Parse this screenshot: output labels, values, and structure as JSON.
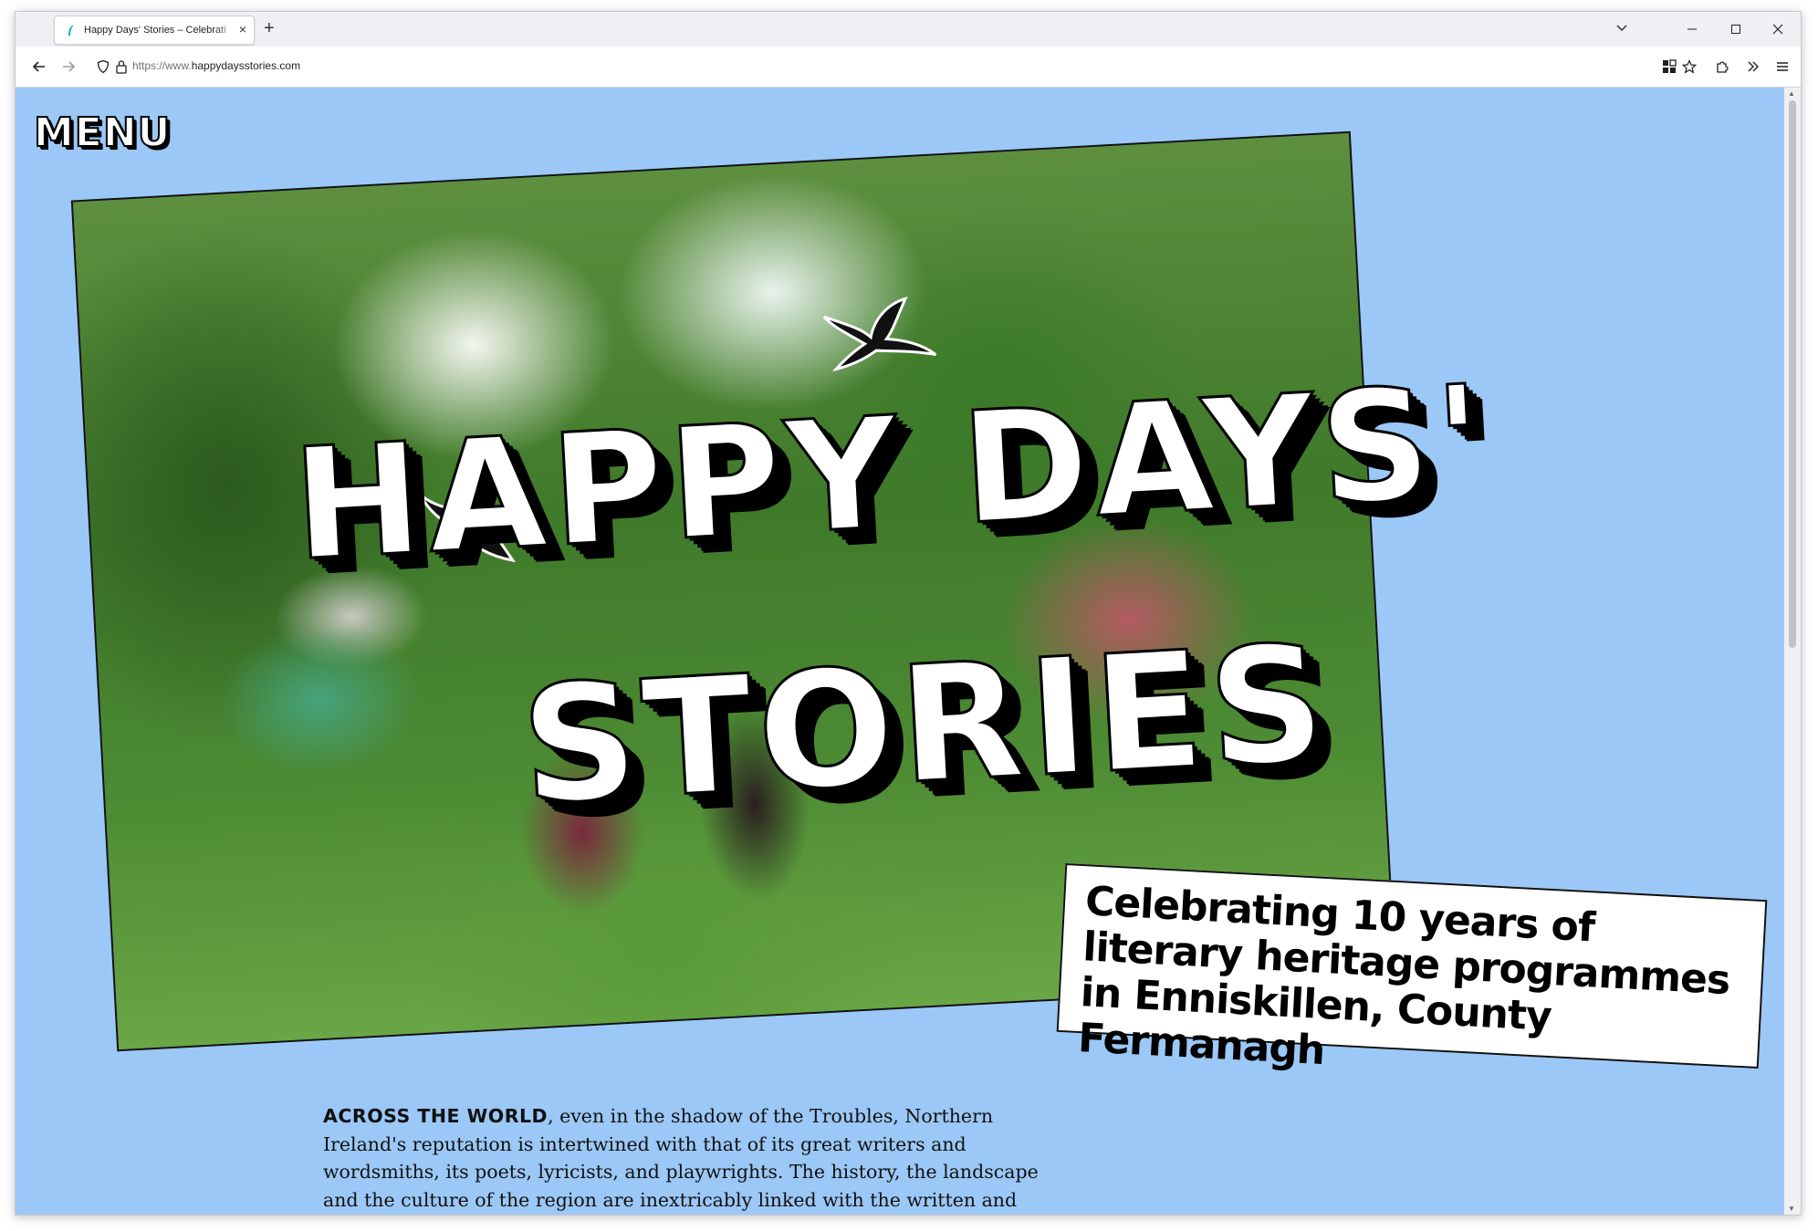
{
  "browser": {
    "tab": {
      "title": "Happy Days' Stories – Celebrati",
      "favicon": "feather-icon",
      "close": "×"
    },
    "new_tab": "+",
    "url": {
      "protocol": "https://www.",
      "domain": "happydaysstories.com"
    }
  },
  "page": {
    "background_color": "#9bc8f6",
    "menu_label": "MENU",
    "title": {
      "line1": "HAPPY DAYS'",
      "line2": "STORIES"
    },
    "subtitle": "Celebrating 10 years of literary heritage programmes in Enniskillen, County Fermanagh",
    "body": {
      "lead_in": "ACROSS THE WORLD",
      "paragraph": ", even in the shadow of the Troubles, Northern Ireland's reputation is intertwined with that of its great writers and wordsmiths, its poets, lyricists, and playwrights. The history, the landscape and the culture of the region are inextricably linked with the written and the spoken word."
    }
  }
}
